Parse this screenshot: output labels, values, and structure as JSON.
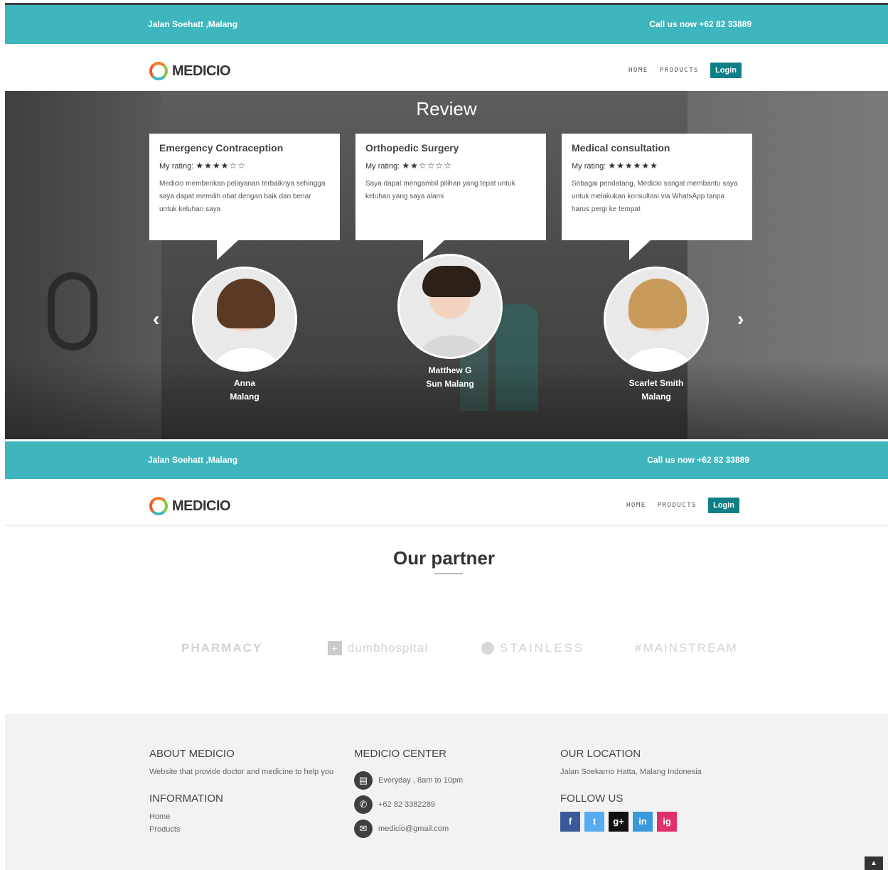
{
  "header_1": {
    "address": "Jalan Soehatt ,Malang",
    "phone": "Call us now +62 82 33889"
  },
  "navbar_1": {
    "logo_text": "MEDICIO",
    "home": "HOME",
    "products": "PRODUCTS",
    "login": "Login"
  },
  "review": {
    "title": "Review",
    "cards": [
      {
        "title": "Emergency Contraception",
        "rating_label": "My rating:",
        "stars": "★★★★☆☆",
        "rating": 4,
        "text": "Medicio memberikan pelayanan terbaiknya sehingga saya dapat memilih obat dengan baik dan benar untuk keluhan saya",
        "name": "Anna",
        "city": "Malang"
      },
      {
        "title": "Orthopedic Surgery",
        "rating_label": "My rating:",
        "stars": "★★☆☆☆☆",
        "rating": 2,
        "text": "Saya dapat mengambil pilihan yang tepat untuk keluhan yang saya alami",
        "name": "Matthew G",
        "city": "Sun Malang"
      },
      {
        "title": "Medical consultation",
        "rating_label": "My rating:",
        "stars": "★★★★★★",
        "rating": 6,
        "text": "Sebagai pendatang, Medicio sangat membantu saya untuk melakukan konsultasi via WhatsApp tanpa harus pergi ke tempat",
        "name": "Scarlet Smith",
        "city": "Malang"
      }
    ],
    "prev_icon": "‹",
    "next_icon": "›"
  },
  "header_2": {
    "address": "Jalan Soehatt ,Malang",
    "phone": "Call us now +62 82 33889"
  },
  "navbar_2": {
    "logo_text": "MEDICIO",
    "home": "HOME",
    "products": "PRODUCTS",
    "login": "Login"
  },
  "partners": {
    "title": "Our partner",
    "logos": [
      "PHARMACY",
      "dumbhospital",
      "STAINLESS",
      "#MAINSTREAM"
    ]
  },
  "footer": {
    "about_title": "ABOUT MEDICIO",
    "about_text": "Website that provide doctor and medicine to help you",
    "info_title": "INFORMATION",
    "info_links": [
      "Home",
      "Products"
    ],
    "center_title": "MEDICIO CENTER",
    "hours": "Everyday , 8am to 10pm",
    "phone": "+62 82 3382289",
    "email": "medicio@gmail.com",
    "location_title": "OUR LOCATION",
    "location_text": "Jalan Soekarno Hatta, Malang Indonesia",
    "follow_title": "FOLLOW US",
    "social": [
      "f",
      "t",
      "g+",
      "in",
      "ig"
    ]
  },
  "colors": {
    "teal": "#3fb6bd",
    "login": "#0e7f86",
    "facebook": "#3b5998",
    "twitter": "#55acee",
    "google": "#111111",
    "linkedin": "#3a9ad9",
    "instagram": "#e1306c"
  }
}
